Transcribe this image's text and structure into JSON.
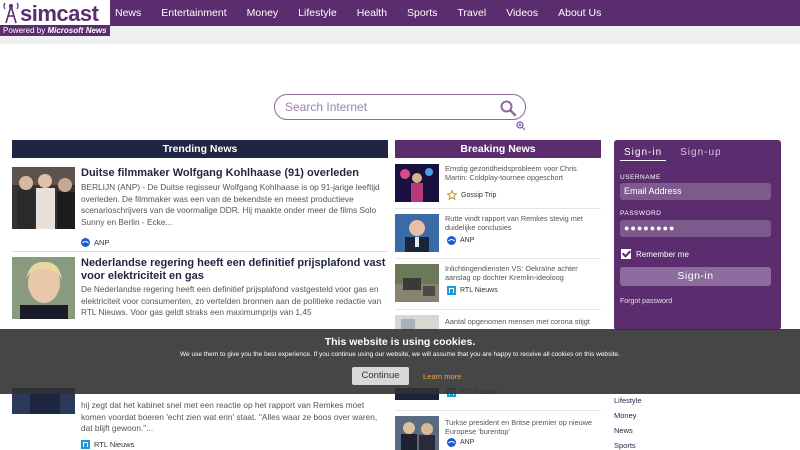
{
  "brand": {
    "name": "simcast",
    "powered_prefix": "Powered by ",
    "powered_name": "Microsoft News"
  },
  "nav": [
    "News",
    "Entertainment",
    "Money",
    "Lifestyle",
    "Health",
    "Sports",
    "Travel",
    "Videos",
    "About Us"
  ],
  "search": {
    "placeholder": "Search Internet"
  },
  "trending": {
    "header": "Trending News",
    "articles": [
      {
        "title": "Duitse filmmaker Wolfgang Kohlhaase (91) overleden",
        "body": "BERLIJN (ANP) - De Duitse regisseur Wolfgang Kohlhaase is op 91-jarige leeftijd overleden. De filmmaker was een van de bekendste en meest productieve scenarioschrijvers van de voormalige DDR. Hij maakte onder meer de films Solo Sunny en Berlin - Ecke...",
        "source": "ANP"
      },
      {
        "title": "Nederlandse regering heeft een definitief prijsplafond vast voor elektriciteit en gas",
        "body": "De Nederlandse regering heeft een definitief prijsplafond vastgesteld voor gas en elektriciteit voor consumenten, zo vertelden bronnen aan de politieke redactie van RTL Nieuws. Voor gas geldt straks een maximumprijs van 1,45",
        "source": "RTL Nieuws"
      },
      {
        "title": "",
        "body": "hij zegt dat het kabinet snel met een reactie op het rapport van Remkes moet komen voordat boeren 'echt zien wat erin' staat. \"Alles waar ze boos over waren, dat blijft gewoon.\"...",
        "source": "RTL Nieuws"
      }
    ]
  },
  "breaking": {
    "header": "Breaking News",
    "items": [
      {
        "title": "Ernstig gezondheidsprobleem voor Chris Martin: Coldplay-tournee opgeschort",
        "source": "Gossip Trip"
      },
      {
        "title": "Rutte vindt rapport van Remkes stevig met duidelijke conclusies",
        "source": "ANP"
      },
      {
        "title": "Inlichtingendiensten VS: Oekraïne achter aanslag op dochter Kremlin-ideoloog",
        "source": "RTL Nieuws"
      },
      {
        "title": "Aantal opgenomen mensen met corona stijgt",
        "source": ""
      },
      {
        "title": "",
        "source": "RTL Nieuws"
      },
      {
        "title": "Turkse president en Britse premier op nieuwe Europese 'burentop'",
        "source": "ANP"
      }
    ]
  },
  "signin": {
    "tabs": [
      "Sign-in",
      "Sign-up"
    ],
    "username_label": "USERNAME",
    "username_placeholder": "Email Address",
    "password_label": "PASSWORD",
    "password_value": "●●●●●●●●",
    "remember": "Remember me",
    "button": "Sign-in",
    "forgot": "Forgot password"
  },
  "side_links": [
    "Lifestyle",
    "Money",
    "News",
    "Sports"
  ],
  "cookie": {
    "title": "This website is using cookies.",
    "message": "We use them to give you the best experience. If you continue using our website, we will assume that you are happy to receive all cookies on this website.",
    "button": "Continue",
    "learn_more": "Learn more"
  },
  "colors": {
    "brand_purple": "#5b2d6e",
    "navy": "#1f2543",
    "cookie_link": "#e8a848"
  }
}
